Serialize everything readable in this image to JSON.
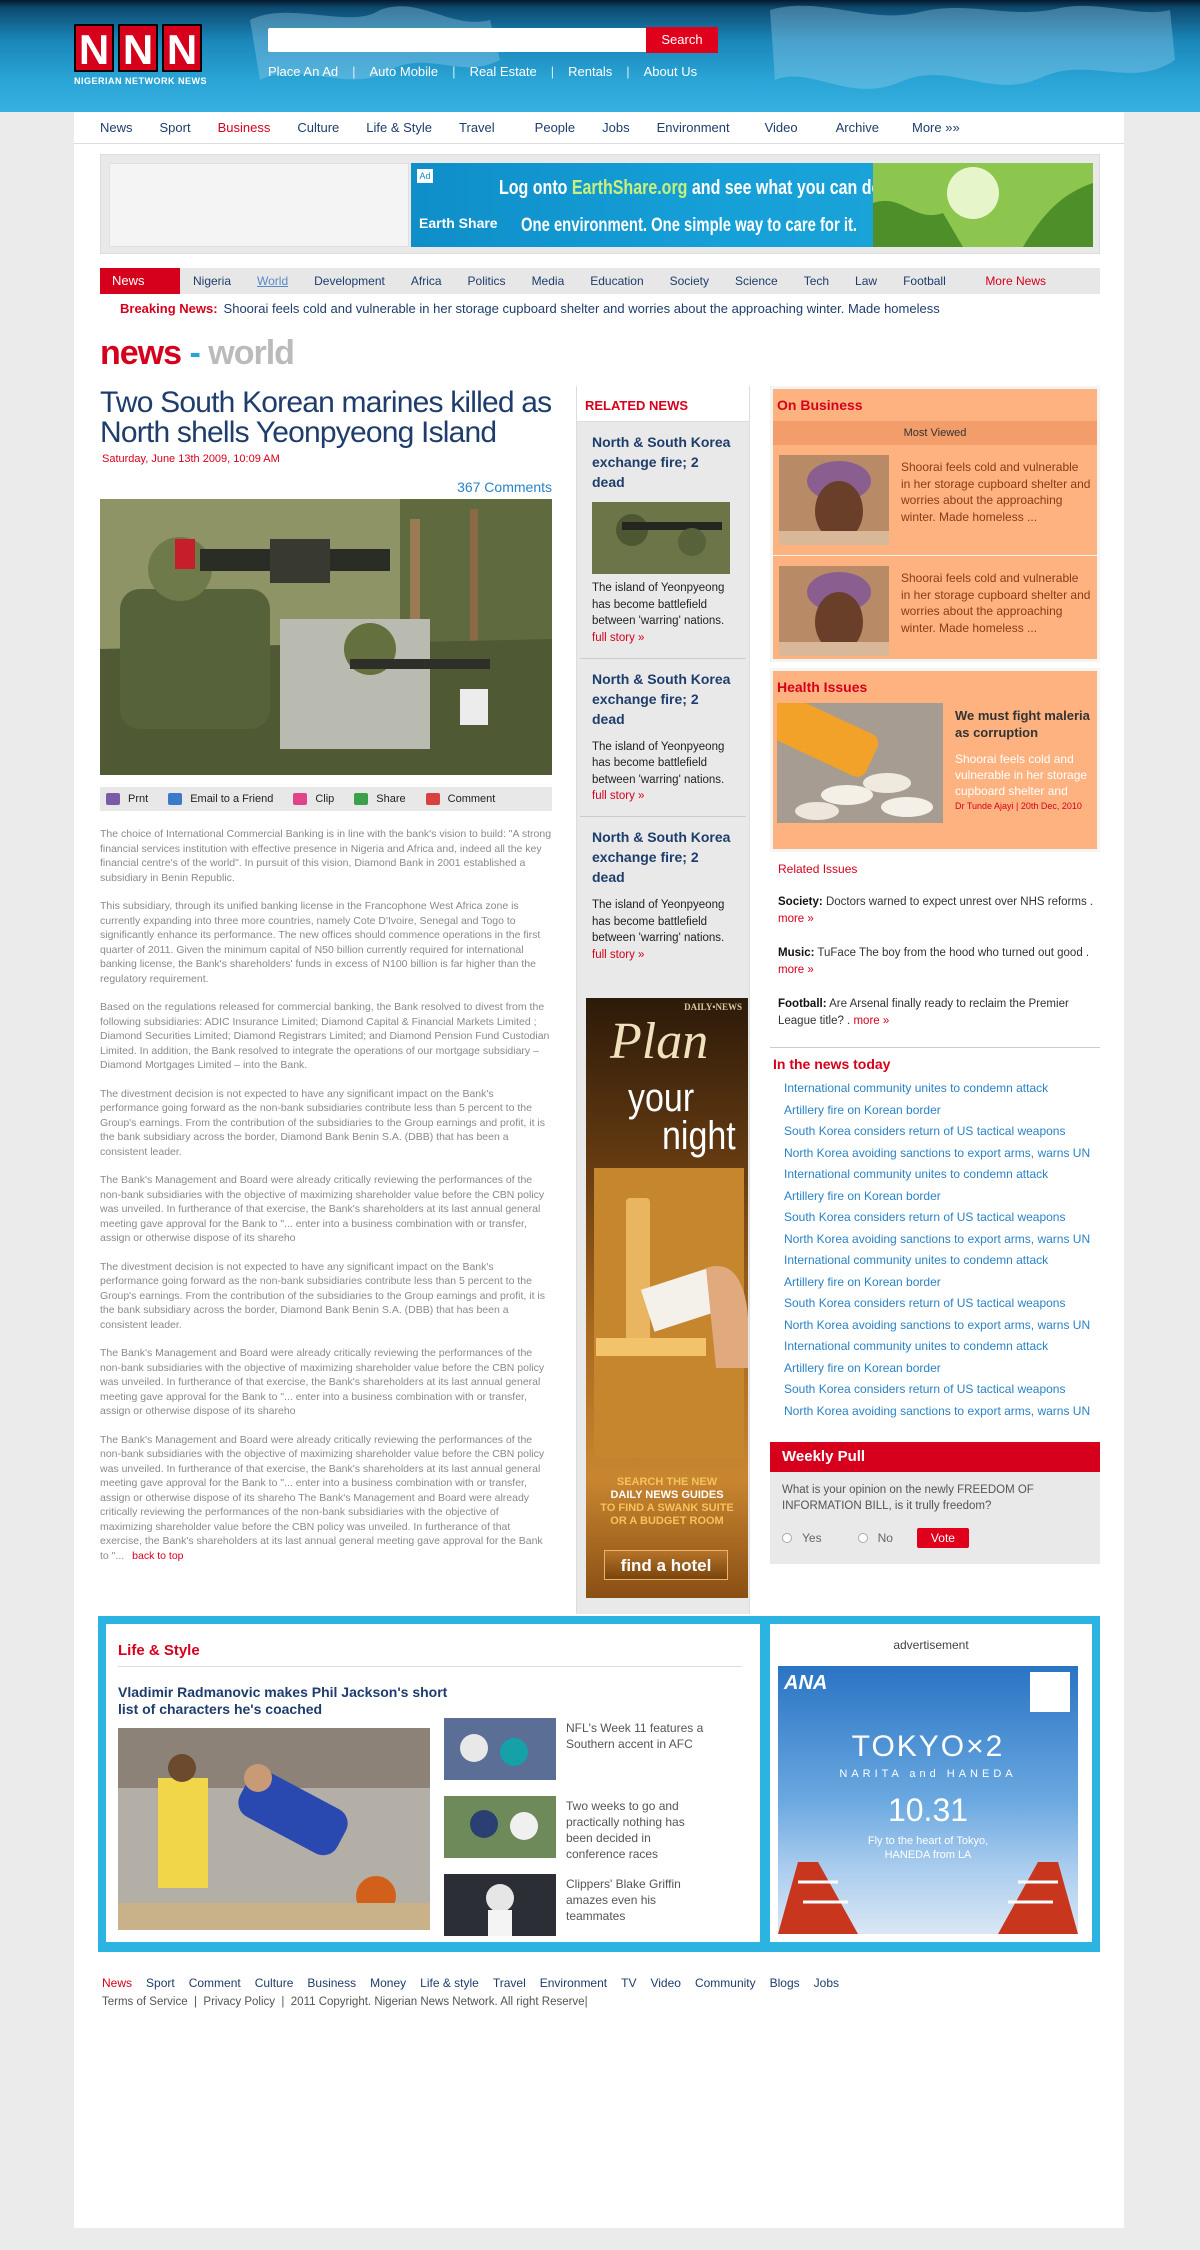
{
  "logo": {
    "letters": [
      "N",
      "N",
      "N"
    ],
    "tagline": "NIGERIAN NETWORK NEWS"
  },
  "search": {
    "value": "",
    "button": "Search"
  },
  "top_links": [
    "Place An Ad",
    "Auto Mobile",
    "Real Estate",
    "Rentals",
    "About Us"
  ],
  "main_nav": {
    "items": [
      "News",
      "Sport",
      "Business",
      "Culture",
      "Life & Style",
      "Travel",
      "People",
      "Jobs",
      "Environment",
      "Video",
      "Archive",
      "More »»"
    ],
    "active": "Business"
  },
  "banner_ad": {
    "line1_prefix": "Log onto ",
    "line1_brand": "EarthShare.org",
    "line1_suffix": " and see what you can do.",
    "brand": "Earth Share",
    "line2": "One environment. One simple way to care for it.",
    "tag": "Ad"
  },
  "sub_nav": {
    "label": "News",
    "items": [
      "Nigeria",
      "World",
      "Development",
      "Africa",
      "Politics",
      "Media",
      "Education",
      "Society",
      "Science",
      "Tech",
      "Law",
      "Football"
    ],
    "current": "World",
    "more": "More News"
  },
  "breaking": {
    "label": "Breaking News:",
    "text": "Shoorai feels cold and vulnerable in her storage cupboard shelter and worries about the approaching winter. Made homeless"
  },
  "section": {
    "news": "news",
    "dash": "-",
    "world": "world"
  },
  "article": {
    "title": "Two South Korean marines killed as North shells Yeonpyeong Island",
    "date": "Saturday, June 13th 2009, 10:09 AM",
    "comments": "367 Comments",
    "tools": [
      "Prnt",
      "Email to a Friend",
      "Clip",
      "Share",
      "Comment"
    ],
    "tool_colors": [
      "#7b5aa6",
      "#3a7ac8",
      "#e0438a",
      "#3aa04a",
      "#d94040"
    ],
    "paragraphs": [
      "The choice of International Commercial Banking is in line with the bank's vision to build: \"A strong financial services institution with effective presence in Nigeria and Africa and, indeed all the key financial centre's of the world\". In pursuit of this vision, Diamond Bank in 2001 established a subsidiary in Benin Republic.",
      "This subsidiary, through its unified banking license in the Francophone West Africa zone is currently expanding into three more countries, namely Cote D'Ivoire, Senegal and Togo to significantly enhance its performance. The new offices should commence operations in the first quarter of 2011. Given the minimum capital of N50 billion currently required for international banking license, the Bank's shareholders' funds in excess of N100 billion is far higher than the regulatory requirement.",
      "Based on the regulations released for commercial banking, the Bank resolved to divest from the following subsidiaries: ADIC Insurance Limited; Diamond Capital & Financial Markets Limited ; Diamond Securities Limited; Diamond Registrars Limited; and Diamond Pension Fund Custodian Limited. In addition, the Bank resolved to integrate the operations of our mortgage subsidiary – Diamond Mortgages Limited – into the Bank.",
      "The divestment decision is not expected to have any significant impact on the Bank's performance going forward as the non-bank subsidiaries contribute less than 5 percent to the Group's earnings. From the contribution of the subsidiaries to the Group earnings and profit, it is the bank subsidiary across the border, Diamond Bank Benin S.A. (DBB) that has been a consistent leader.",
      "The Bank's Management and Board were already critically reviewing the performances of the non-bank subsidiaries with the objective of maximizing shareholder value before the CBN policy was unveiled. In furtherance of that exercise, the Bank's shareholders at its last annual general meeting gave approval for the Bank to \"... enter into a business combination with or transfer, assign or otherwise dispose of its shareho",
      "The divestment decision is not expected to have any significant impact on the Bank's performance going forward as the non-bank subsidiaries contribute less than 5 percent to the Group's earnings. From the contribution of the subsidiaries to the Group earnings and profit, it is the bank subsidiary across the border, Diamond Bank Benin S.A. (DBB) that has been a consistent leader.",
      "The Bank's Management and Board were already critically reviewing the performances of the non-bank subsidiaries with the objective of maximizing shareholder value before the CBN policy was unveiled. In furtherance of that exercise, the Bank's shareholders at its last annual general meeting gave approval for the Bank to \"... enter into a business combination with or transfer, assign or otherwise dispose of its shareho",
      "The Bank's Management and Board were already critically reviewing the performances of the non-bank subsidiaries with the objective of maximizing shareholder value before the CBN policy was unveiled. In furtherance of that exercise, the Bank's shareholders at its last annual general meeting gave approval for the Bank to \"... enter into a business combination with or transfer, assign or otherwise dispose of its shareho The Bank's Management and Board were already critically reviewing the performances of the non-bank subsidiaries with the objective of maximizing shareholder value before the CBN policy was unveiled. In furtherance of that exercise, the Bank's shareholders at its last annual general meeting gave approval for the Bank to \"..."
    ],
    "back_to_top": "back to top"
  },
  "related": {
    "header": "RELATED NEWS",
    "items": [
      {
        "title": "North & South Korea exchange fire; 2 dead",
        "text": "The island of Yeonpyeong has become battlefield between 'warring' nations.",
        "link": "full story »"
      },
      {
        "title": "North & South Korea exchange fire; 2 dead",
        "text": "The island of Yeonpyeong has become battlefield between 'warring' nations.",
        "link": "full story »"
      },
      {
        "title": "North & South Korea exchange fire; 2 dead",
        "text": "The island of Yeonpyeong has become battlefield between 'warring' nations.",
        "link": "full story »"
      }
    ]
  },
  "hotel_ad": {
    "brand": "DAILY•NEWS",
    "plan": "Plan",
    "your": "your",
    "night": "night",
    "search1": "SEARCH THE NEW",
    "search2": "DAILY NEWS GUIDES",
    "search3": "TO FIND A SWANK SUITE",
    "search4": "OR A BUDGET ROOM",
    "button": "find a hotel"
  },
  "on_business": {
    "title": "On Business",
    "tab": "Most Viewed",
    "items": [
      "Shoorai feels cold and vulnerable in her storage cupboard shelter and worries about the approaching winter. Made homeless ...",
      "Shoorai feels cold and vulnerable in her storage cupboard shelter and worries about the approaching winter. Made homeless ..."
    ]
  },
  "health": {
    "title": "Health Issues",
    "headline": "We must fight maleria as corruption",
    "text": "Shoorai feels cold and vulnerable in her storage cupboard shelter and",
    "byline": "Dr Tunde Ajayi | 20th Dec, 2010"
  },
  "related_issues": {
    "label": "Related Issues",
    "items": [
      {
        "cat": "Society:",
        "text": " Doctors warned to expect unrest over NHS reforms .",
        "more": "more »"
      },
      {
        "cat": "Music:",
        "text": " TuFace The boy from the hood who turned out good .",
        "more": "more »"
      },
      {
        "cat": "Football:",
        "text": " Are Arsenal finally ready to reclaim the Premier League title? .",
        "more": "more »"
      }
    ]
  },
  "in_the_news": {
    "title": "In the news today",
    "items": [
      "International community unites to condemn attack",
      "Artillery fire on Korean border",
      "South Korea considers return of US tactical weapons",
      "North Korea avoiding sanctions to export arms, warns UN",
      "International community unites to condemn attack",
      "Artillery fire on Korean border",
      "South Korea considers return of US tactical weapons",
      "North Korea avoiding sanctions to export arms, warns UN",
      "International community unites to condemn attack",
      "Artillery fire on Korean border",
      "South Korea considers return of US tactical weapons",
      "North Korea avoiding sanctions to export arms, warns UN",
      "International community unites to condemn attack",
      "Artillery fire on Korean border",
      "South Korea considers return of US tactical weapons",
      "North Korea avoiding sanctions to export arms, warns UN"
    ]
  },
  "poll": {
    "title": "Weekly Pull",
    "question": "What is your opinion on the newly FREEDOM OF INFORMATION BILL, is it trully freedom?",
    "yes": "Yes",
    "no": "No",
    "vote": "Vote"
  },
  "life_style": {
    "title": "Life & Style",
    "headline": "Vladimir Radmanovic makes Phil Jackson's short list of characters he's coached",
    "side": [
      "NFL's Week 11 features a Southern accent in AFC",
      "Two weeks to go and practically nothing has been decided in conference races",
      "Clippers' Blake Griffin amazes even his teammates"
    ]
  },
  "advert": {
    "caption": "advertisement",
    "brand": "ANA",
    "tokyo": "TOKYO×2",
    "sub": "NARITA and HANEDA",
    "date": "10.31",
    "tag1": "Fly to the heart of Tokyo,",
    "tag2": "HANEDA from LA"
  },
  "footer": {
    "links": [
      "News",
      "Sport",
      "Comment",
      "Culture",
      "Business",
      "Money",
      "Life & style",
      "Travel",
      "Environment",
      "TV",
      "Video",
      "Community",
      "Blogs",
      "Jobs"
    ],
    "terms": "Terms of Service",
    "privacy": "Privacy Policy",
    "copyright": "2011 Copyright. Nigerian News Network. All right Reserve|"
  }
}
